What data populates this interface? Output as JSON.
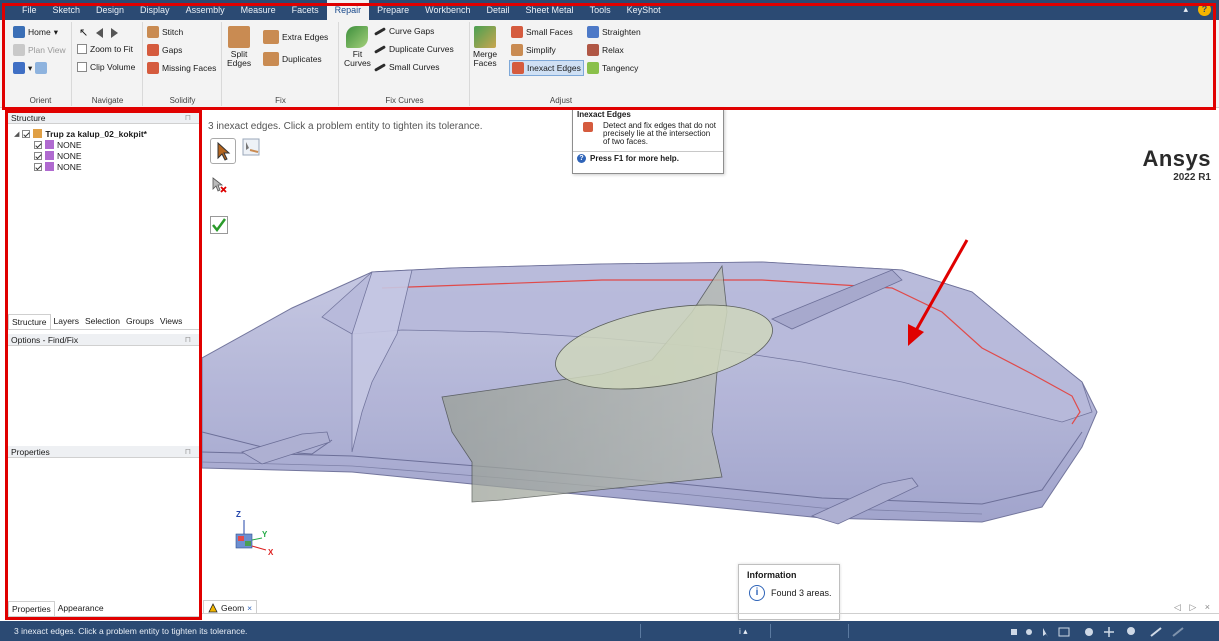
{
  "menu": {
    "items": [
      "File",
      "Sketch",
      "Design",
      "Display",
      "Assembly",
      "Measure",
      "Facets",
      "Repair",
      "Prepare",
      "Workbench",
      "Detail",
      "Sheet Metal",
      "Tools",
      "KeyShot"
    ],
    "active": "Repair",
    "minimize_glyph": "▴",
    "help_glyph": "?"
  },
  "ribbon": {
    "orient": {
      "label": "Orient",
      "home": "Home",
      "plan_view": "Plan View"
    },
    "navigate": {
      "label": "Navigate",
      "zoom_to_fit": "Zoom to Fit",
      "clip_volume": "Clip Volume"
    },
    "solidify": {
      "label": "Solidify",
      "stitch": "Stitch",
      "gaps": "Gaps",
      "missing_faces": "Missing Faces"
    },
    "fix": {
      "label": "Fix",
      "split_edges_1": "Split",
      "split_edges_2": "Edges",
      "extra_edges": "Extra Edges",
      "duplicates": "Duplicates"
    },
    "fix_curves": {
      "label": "Fix Curves",
      "fit_curves_1": "Fit",
      "fit_curves_2": "Curves",
      "curve_gaps": "Curve Gaps",
      "duplicate_curves": "Duplicate Curves",
      "small_curves": "Small Curves"
    },
    "adjust": {
      "label": "Adjust",
      "merge_faces_1": "Merge",
      "merge_faces_2": "Faces",
      "small_faces": "Small Faces",
      "simplify": "Simplify",
      "inexact_edges": "Inexact Edges",
      "straighten": "Straighten",
      "relax": "Relax",
      "tangency": "Tangency"
    }
  },
  "structure": {
    "header": "Structure",
    "root": "Trup za kalup_02_kokpit*",
    "children": [
      "NONE",
      "NONE",
      "NONE"
    ]
  },
  "panel_tabs": [
    "Structure",
    "Layers",
    "Selection",
    "Groups",
    "Views"
  ],
  "options_header": "Options - Find/Fix",
  "properties_header": "Properties",
  "bottom_tabs": [
    "Properties",
    "Appearance"
  ],
  "viewport": {
    "hint": "3 inexact edges. Click a problem entity to tighten its tolerance.",
    "brand": "Ansys",
    "version": "2022 R1",
    "triad": {
      "z": "Z",
      "y": "Y",
      "x": "X"
    }
  },
  "tooltip": {
    "title": "Inexact Edges",
    "description": "Detect and fix edges that do not precisely lie at the intersection of two faces.",
    "help": "Press F1 for more help."
  },
  "info": {
    "title": "Information",
    "message": "Found 3 areas."
  },
  "doc_tab": {
    "label": "Geom",
    "close": "×"
  },
  "doc_nav": "◁ ▷ ×",
  "status": {
    "message": "3 inexact edges. Click a problem entity to tighten its tolerance.",
    "info_glyph": "i ▴"
  },
  "colors": {
    "title_bar": "#2b4a73",
    "annotation_red": "#e00000",
    "model_fill": "#a9acd3",
    "inexact_edge": "#e04a4a"
  }
}
